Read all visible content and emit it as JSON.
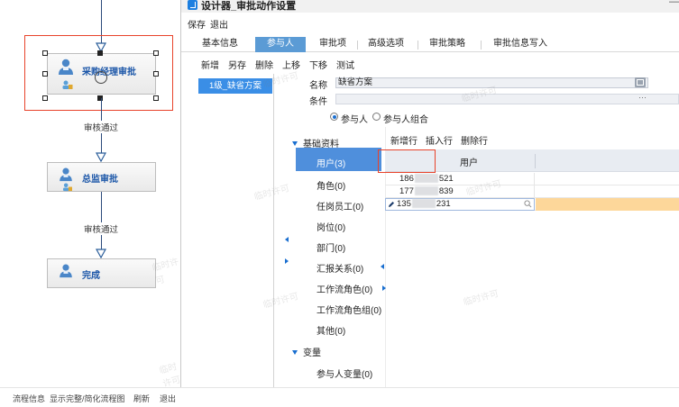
{
  "window": {
    "title": "设计器_审批动作设置",
    "control": "—"
  },
  "menubar": {
    "save": "保存",
    "exit": "退出"
  },
  "tabs": [
    "基本信息",
    "参与人",
    "审批项",
    "高级选项",
    "审批策略",
    "审批信息写入"
  ],
  "active_tab": "参与人",
  "toolbar": [
    "新增",
    "另存",
    "删除",
    "上移",
    "下移",
    "测试"
  ],
  "scheme_list": {
    "selected": "1级_缺省方案"
  },
  "form": {
    "name_label": "名称",
    "name_value": "缺省方案",
    "condition_label": "条件",
    "condition_btn": "···",
    "radio_participant": "参与人",
    "radio_group": "参与人组合"
  },
  "tree": {
    "basic_header": "基础资料",
    "items": [
      "用户(3)",
      "角色(0)",
      "任岗员工(0)",
      "岗位(0)",
      "部门(0)",
      "汇报关系(0)",
      "工作流角色(0)",
      "工作流角色组(0)",
      "其他(0)"
    ],
    "var_header": "变量",
    "var_items": [
      "参与人变量(0)"
    ],
    "selected": "用户(3)"
  },
  "grid_toolbar": {
    "add_row": "新增行",
    "insert_row": "插入行",
    "delete_row": "删除行"
  },
  "grid": {
    "column": "用户",
    "rows": [
      {
        "prefix": "186",
        "suffix": "521"
      },
      {
        "prefix": "177",
        "suffix": "839"
      },
      {
        "prefix": "135",
        "suffix": "231"
      }
    ]
  },
  "workflow": {
    "nodes": [
      "采购经理审批",
      "总监审批",
      "完成"
    ],
    "edges": [
      "审核通过",
      "审核通过"
    ]
  },
  "statusbar": [
    "流程信息",
    "显示完整/简化流程图",
    "刷新",
    "退出"
  ],
  "watermark": "临时许可",
  "colors": {
    "accent": "#5b9bd5",
    "selection": "#e8432b",
    "tree_selected": "#4f8fdc",
    "edit_row": "#fdd79a"
  }
}
